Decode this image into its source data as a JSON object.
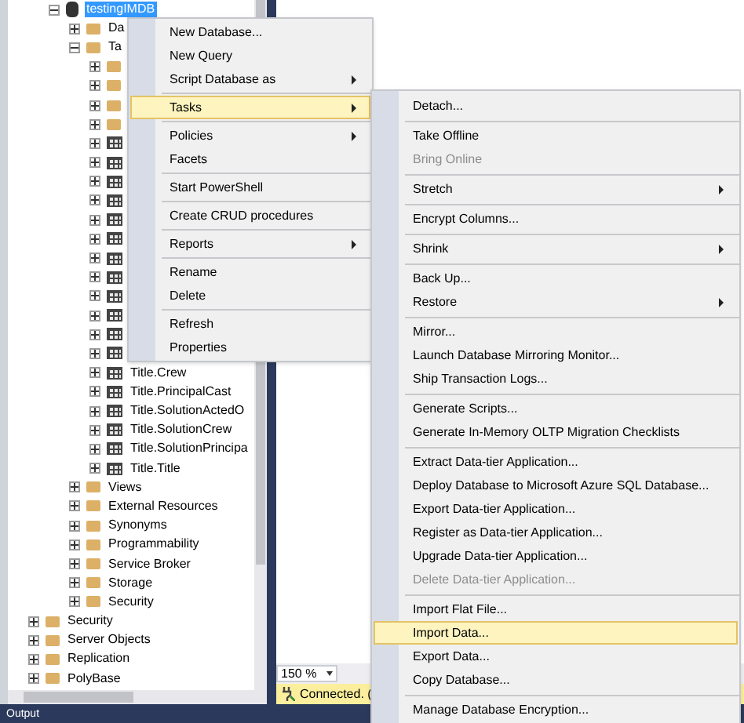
{
  "database_node": {
    "label": "testingIMDB",
    "selected": true,
    "expanded": true,
    "children": [
      {
        "label": "Da",
        "kind": "folder",
        "expanded": false
      },
      {
        "label": "Ta",
        "kind": "folder",
        "expanded": true,
        "children": [
          {
            "kind": "folder",
            "expanded": false
          },
          {
            "kind": "folder",
            "expanded": false
          },
          {
            "kind": "folder",
            "expanded": false
          },
          {
            "kind": "folder",
            "expanded": false
          },
          {
            "kind": "table",
            "expanded": false
          },
          {
            "kind": "table",
            "expanded": false
          },
          {
            "kind": "table",
            "expanded": false
          },
          {
            "kind": "table",
            "expanded": false
          },
          {
            "kind": "table",
            "expanded": false
          },
          {
            "kind": "table",
            "expanded": false
          },
          {
            "kind": "table",
            "expanded": false
          },
          {
            "kind": "table",
            "expanded": false
          },
          {
            "kind": "table",
            "expanded": false
          },
          {
            "kind": "table",
            "expanded": false
          },
          {
            "kind": "table",
            "expanded": false
          },
          {
            "kind": "table",
            "expanded": false
          },
          {
            "label": "Title.Crew",
            "kind": "table",
            "expanded": false
          },
          {
            "label": "Title.PrincipalCast",
            "kind": "table",
            "expanded": false
          },
          {
            "label": "Title.SolutionActedO",
            "kind": "table",
            "expanded": false
          },
          {
            "label": "Title.SolutionCrew",
            "kind": "table",
            "expanded": false
          },
          {
            "label": "Title.SolutionPrincipa",
            "kind": "table",
            "expanded": false
          },
          {
            "label": "Title.Title",
            "kind": "table",
            "expanded": false
          }
        ]
      },
      {
        "label": "Views",
        "kind": "folder",
        "expanded": false
      },
      {
        "label": "External Resources",
        "kind": "folder",
        "expanded": false
      },
      {
        "label": "Synonyms",
        "kind": "folder",
        "expanded": false
      },
      {
        "label": "Programmability",
        "kind": "folder",
        "expanded": false
      },
      {
        "label": "Service Broker",
        "kind": "folder",
        "expanded": false
      },
      {
        "label": "Storage",
        "kind": "folder",
        "expanded": false
      },
      {
        "label": "Security",
        "kind": "folder",
        "expanded": false
      }
    ]
  },
  "server_nodes": [
    {
      "label": "Security",
      "kind": "folder",
      "expanded": false
    },
    {
      "label": "Server Objects",
      "kind": "folder",
      "expanded": false
    },
    {
      "label": "Replication",
      "kind": "folder",
      "expanded": false
    },
    {
      "label": "PolyBase",
      "kind": "folder",
      "expanded": false
    }
  ],
  "zoom": "150 %",
  "status": "Connected. (",
  "output_label": "Output",
  "context_menu": [
    {
      "kind": "item",
      "label": "New Database...",
      "submenu": false,
      "selected": false
    },
    {
      "kind": "item",
      "label": "New Query",
      "submenu": false,
      "selected": false
    },
    {
      "kind": "item",
      "label": "Script Database as",
      "submenu": true,
      "selected": false
    },
    {
      "kind": "separator"
    },
    {
      "kind": "item",
      "label": "Tasks",
      "submenu": true,
      "selected": true
    },
    {
      "kind": "separator"
    },
    {
      "kind": "item",
      "label": "Policies",
      "submenu": true,
      "selected": false
    },
    {
      "kind": "item",
      "label": "Facets",
      "submenu": false,
      "selected": false
    },
    {
      "kind": "separator"
    },
    {
      "kind": "item",
      "label": "Start PowerShell",
      "submenu": false,
      "selected": false
    },
    {
      "kind": "separator"
    },
    {
      "kind": "item",
      "label": "Create CRUD procedures",
      "submenu": false,
      "selected": false
    },
    {
      "kind": "separator"
    },
    {
      "kind": "item",
      "label": "Reports",
      "submenu": true,
      "selected": false
    },
    {
      "kind": "separator"
    },
    {
      "kind": "item",
      "label": "Rename",
      "submenu": false,
      "selected": false
    },
    {
      "kind": "item",
      "label": "Delete",
      "submenu": false,
      "selected": false
    },
    {
      "kind": "separator"
    },
    {
      "kind": "item",
      "label": "Refresh",
      "submenu": false,
      "selected": false
    },
    {
      "kind": "item",
      "label": "Properties",
      "submenu": false,
      "selected": false
    }
  ],
  "tasks_submenu": [
    {
      "kind": "item",
      "label": "Detach...",
      "submenu": false,
      "selected": false,
      "disabled": false
    },
    {
      "kind": "separator"
    },
    {
      "kind": "item",
      "label": "Take Offline",
      "submenu": false,
      "selected": false,
      "disabled": false
    },
    {
      "kind": "item",
      "label": "Bring Online",
      "submenu": false,
      "selected": false,
      "disabled": true
    },
    {
      "kind": "separator"
    },
    {
      "kind": "item",
      "label": "Stretch",
      "submenu": true,
      "selected": false,
      "disabled": false
    },
    {
      "kind": "separator"
    },
    {
      "kind": "item",
      "label": "Encrypt Columns...",
      "submenu": false,
      "selected": false,
      "disabled": false
    },
    {
      "kind": "separator"
    },
    {
      "kind": "item",
      "label": "Shrink",
      "submenu": true,
      "selected": false,
      "disabled": false
    },
    {
      "kind": "separator"
    },
    {
      "kind": "item",
      "label": "Back Up...",
      "submenu": false,
      "selected": false,
      "disabled": false
    },
    {
      "kind": "item",
      "label": "Restore",
      "submenu": true,
      "selected": false,
      "disabled": false
    },
    {
      "kind": "separator"
    },
    {
      "kind": "item",
      "label": "Mirror...",
      "submenu": false,
      "selected": false,
      "disabled": false
    },
    {
      "kind": "item",
      "label": "Launch Database Mirroring Monitor...",
      "submenu": false,
      "selected": false,
      "disabled": false
    },
    {
      "kind": "item",
      "label": "Ship Transaction Logs...",
      "submenu": false,
      "selected": false,
      "disabled": false
    },
    {
      "kind": "separator"
    },
    {
      "kind": "item",
      "label": "Generate Scripts...",
      "submenu": false,
      "selected": false,
      "disabled": false
    },
    {
      "kind": "item",
      "label": "Generate In-Memory OLTP Migration Checklists",
      "submenu": false,
      "selected": false,
      "disabled": false
    },
    {
      "kind": "separator"
    },
    {
      "kind": "item",
      "label": "Extract Data-tier Application...",
      "submenu": false,
      "selected": false,
      "disabled": false
    },
    {
      "kind": "item",
      "label": "Deploy Database to Microsoft Azure SQL Database...",
      "submenu": false,
      "selected": false,
      "disabled": false
    },
    {
      "kind": "item",
      "label": "Export Data-tier Application...",
      "submenu": false,
      "selected": false,
      "disabled": false
    },
    {
      "kind": "item",
      "label": "Register as Data-tier Application...",
      "submenu": false,
      "selected": false,
      "disabled": false
    },
    {
      "kind": "item",
      "label": "Upgrade Data-tier Application...",
      "submenu": false,
      "selected": false,
      "disabled": false
    },
    {
      "kind": "item",
      "label": "Delete Data-tier Application...",
      "submenu": false,
      "selected": false,
      "disabled": true
    },
    {
      "kind": "separator"
    },
    {
      "kind": "item",
      "label": "Import Flat File...",
      "submenu": false,
      "selected": false,
      "disabled": false
    },
    {
      "kind": "item",
      "label": "Import Data...",
      "submenu": false,
      "selected": true,
      "disabled": false
    },
    {
      "kind": "item",
      "label": "Export Data...",
      "submenu": false,
      "selected": false,
      "disabled": false
    },
    {
      "kind": "item",
      "label": "Copy Database...",
      "submenu": false,
      "selected": false,
      "disabled": false
    },
    {
      "kind": "separator"
    },
    {
      "kind": "item",
      "label": "Manage Database Encryption...",
      "submenu": false,
      "selected": false,
      "disabled": false
    }
  ]
}
